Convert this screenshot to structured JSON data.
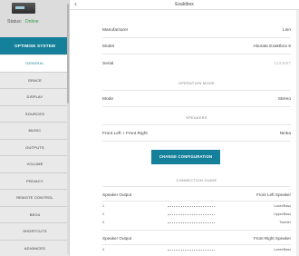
{
  "sidebar": {
    "status_label": "Status:",
    "status_value": "Online",
    "optimise_label": "OPTIMISE SYSTEM",
    "items": [
      {
        "label": "General",
        "active": true
      },
      {
        "label": "Grace",
        "active": false
      },
      {
        "label": "Display",
        "active": false
      },
      {
        "label": "Sources",
        "active": false
      },
      {
        "label": "Music",
        "active": false
      },
      {
        "label": "Outputs",
        "active": false
      },
      {
        "label": "Volume",
        "active": false
      },
      {
        "label": "Privacy",
        "active": false
      },
      {
        "label": "Remote Control",
        "active": false
      },
      {
        "label": "Beo4",
        "active": false
      },
      {
        "label": "Shortcuts",
        "active": false
      },
      {
        "label": "Advanced",
        "active": false
      }
    ]
  },
  "header": {
    "back_icon": "‹",
    "title": "Exaktbox"
  },
  "info": {
    "manufacturer_label": "Manufacturer",
    "manufacturer_value": "Linn",
    "model_label": "Model",
    "model_value": "Akurate Exaktbox 6",
    "serial_label": "Serial",
    "serial_value": "1234567"
  },
  "operation_mode": {
    "title": "OPERATION MODE",
    "mode_label": "Mode",
    "mode_value": "Stereo"
  },
  "speakers": {
    "title": "SPEAKERS",
    "row_label": "Front Left + Front Right",
    "row_value": "Ninka",
    "chevron_icon": "›",
    "change_button": "CHANGE CONFIGURATION"
  },
  "guide": {
    "title": "CONNECTION GUIDE",
    "groups": [
      {
        "output_label": "Speaker Output",
        "speaker_label": "Front Left Speaker",
        "rows": [
          {
            "num": "1",
            "driver": "Lower/Bass"
          },
          {
            "num": "2",
            "driver": "Upper/Bass"
          },
          {
            "num": "3",
            "driver": "Tweeter"
          }
        ]
      },
      {
        "output_label": "Speaker Output",
        "speaker_label": "Front Right Speaker",
        "rows": [
          {
            "num": "4",
            "driver": "Lower/Bass"
          }
        ]
      }
    ]
  },
  "colors": {
    "accent": "#15809a",
    "online": "#2e9a3c"
  }
}
